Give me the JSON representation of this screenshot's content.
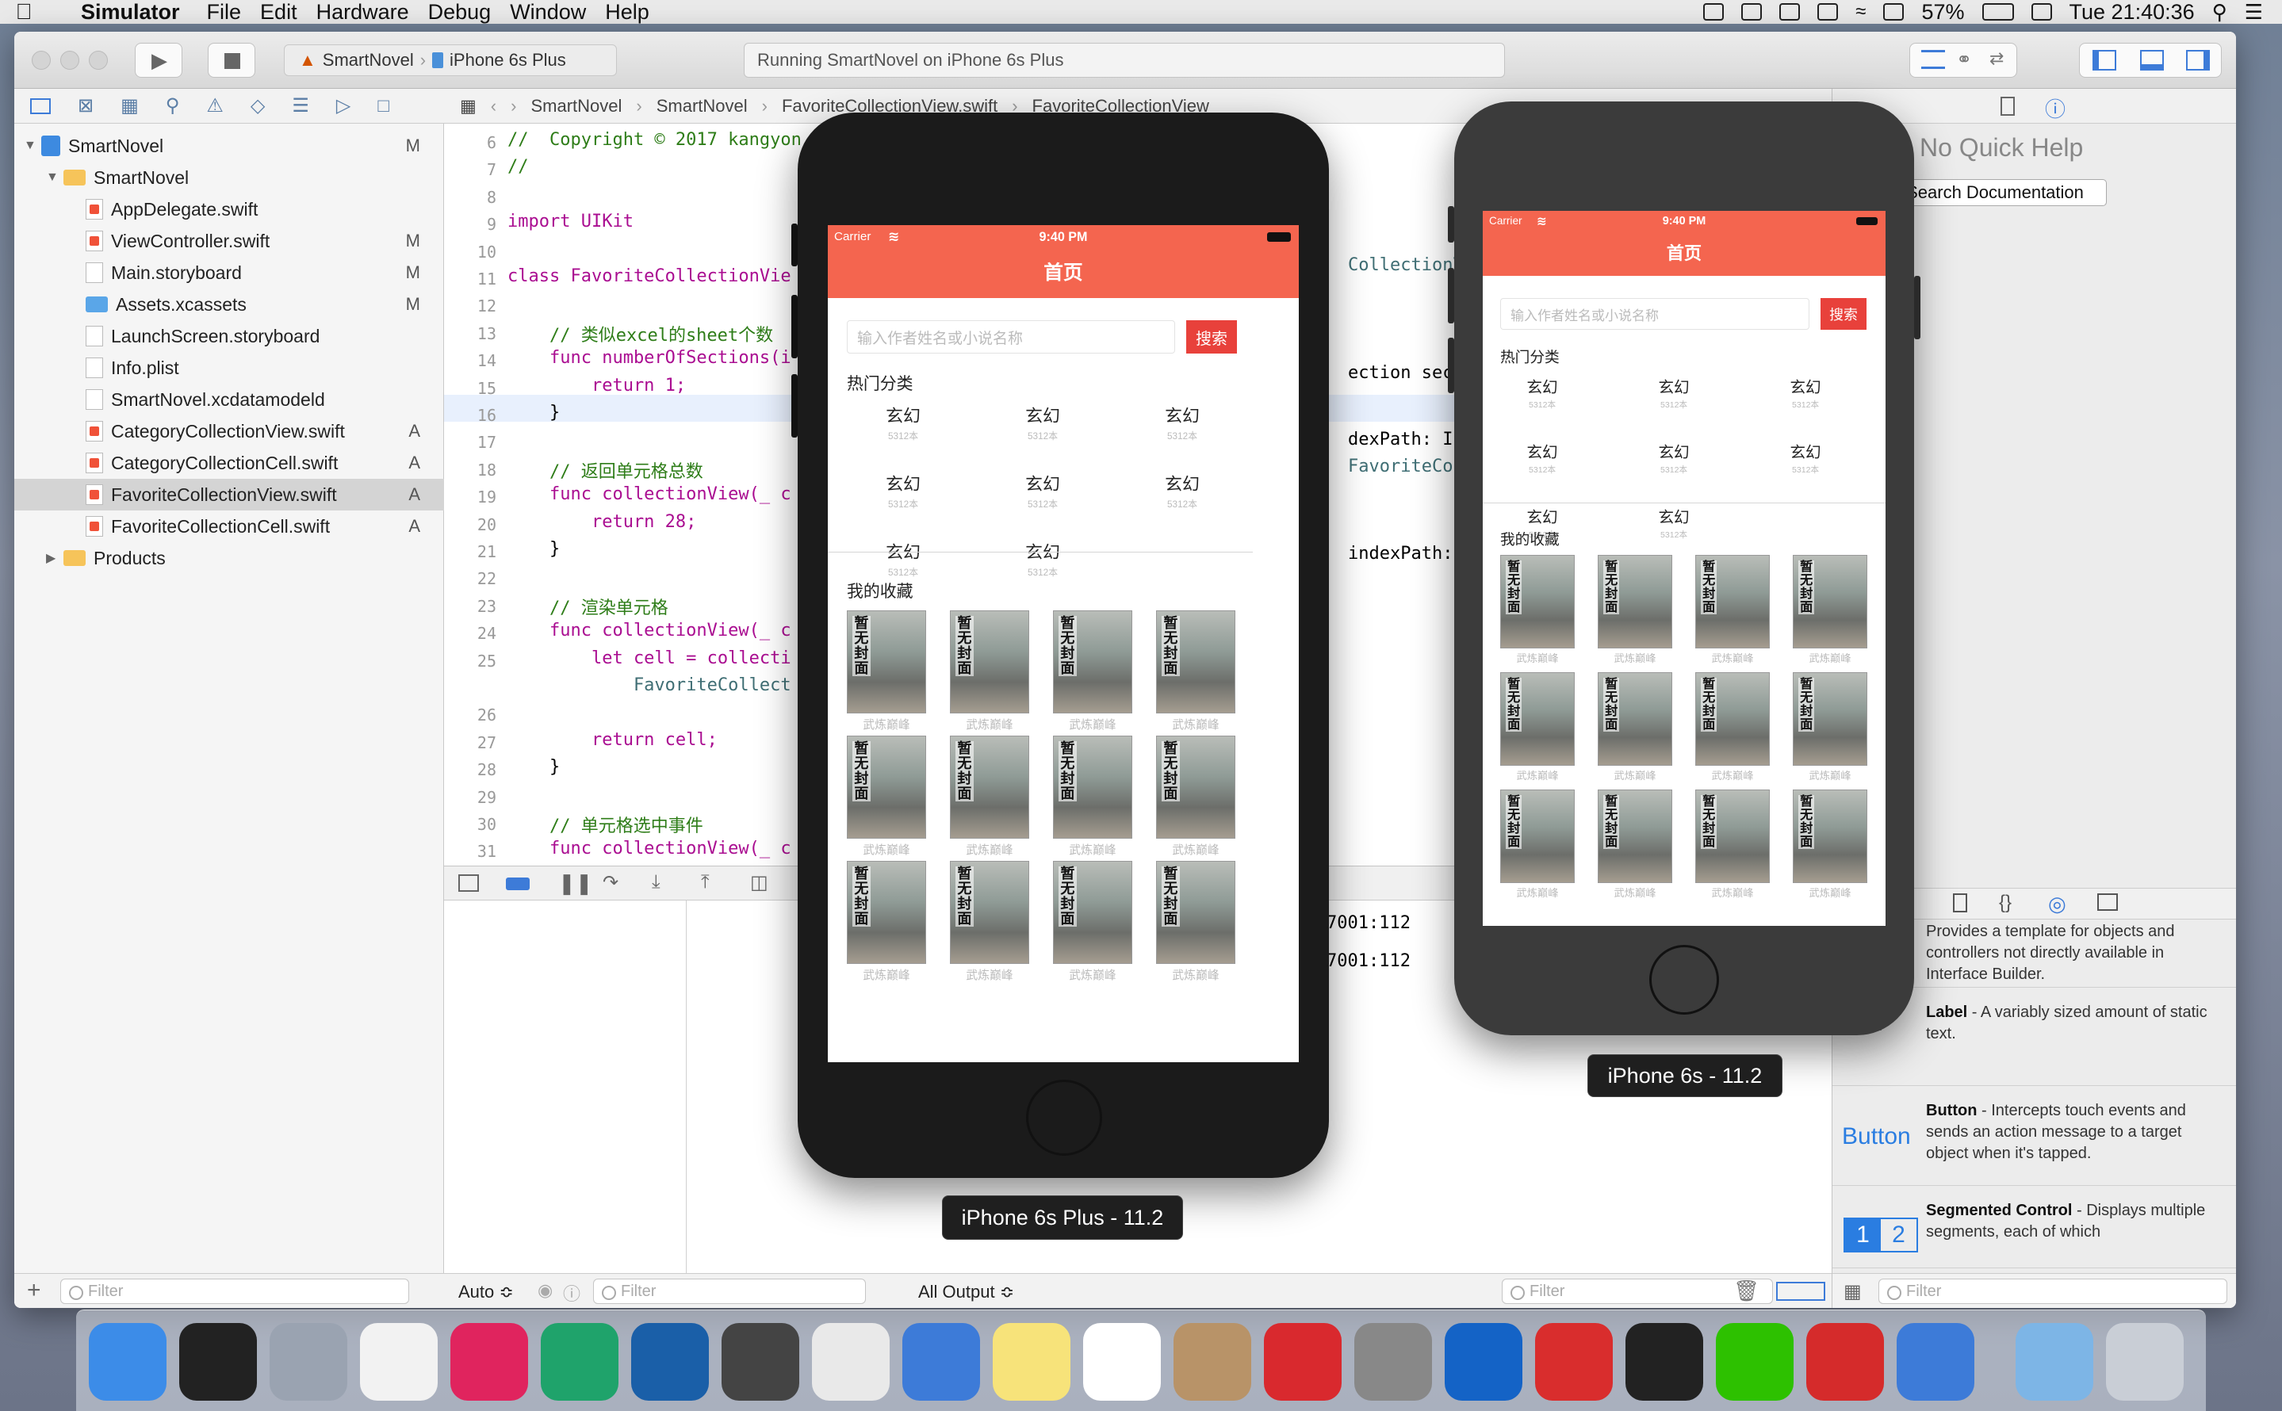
{
  "menubar": {
    "app": "Simulator",
    "items": [
      "File",
      "Edit",
      "Hardware",
      "Debug",
      "Window",
      "Help"
    ],
    "battery": "57%",
    "clock": "Tue 21:40:36"
  },
  "toolbar": {
    "scheme": "SmartNovel",
    "device": "iPhone 6s Plus",
    "status": "Running SmartNovel on iPhone 6s Plus"
  },
  "jumpbar": {
    "crumbs": [
      "SmartNovel",
      "SmartNovel",
      "FavoriteCollectionView.swift",
      "FavoriteCollectionView"
    ]
  },
  "navigator": {
    "items": [
      {
        "label": "SmartNovel",
        "badge": "M",
        "kind": "project",
        "level": 0
      },
      {
        "label": "SmartNovel",
        "badge": "",
        "kind": "folder",
        "level": 1
      },
      {
        "label": "AppDelegate.swift",
        "badge": "",
        "kind": "swift",
        "level": 2
      },
      {
        "label": "ViewController.swift",
        "badge": "M",
        "kind": "swift",
        "level": 2
      },
      {
        "label": "Main.storyboard",
        "badge": "M",
        "kind": "file",
        "level": 2
      },
      {
        "label": "Assets.xcassets",
        "badge": "M",
        "kind": "folder",
        "level": 2
      },
      {
        "label": "LaunchScreen.storyboard",
        "badge": "",
        "kind": "file",
        "level": 2
      },
      {
        "label": "Info.plist",
        "badge": "",
        "kind": "file",
        "level": 2
      },
      {
        "label": "SmartNovel.xcdatamodeld",
        "badge": "",
        "kind": "file",
        "level": 2
      },
      {
        "label": "CategoryCollectionView.swift",
        "badge": "A",
        "kind": "swift",
        "level": 2
      },
      {
        "label": "CategoryCollectionCell.swift",
        "badge": "A",
        "kind": "swift",
        "level": 2
      },
      {
        "label": "FavoriteCollectionView.swift",
        "badge": "A",
        "kind": "swift",
        "level": 2,
        "selected": true
      },
      {
        "label": "FavoriteCollectionCell.swift",
        "badge": "A",
        "kind": "swift",
        "level": 2
      },
      {
        "label": "Products",
        "badge": "",
        "kind": "folder",
        "level": 1
      }
    ],
    "filter_placeholder": "Filter"
  },
  "code": [
    {
      "n": "6",
      "t": "//  Copyright © 2017 kangyon",
      "c": "cm"
    },
    {
      "n": "7",
      "t": "//",
      "c": "cm"
    },
    {
      "n": "8",
      "t": "",
      "c": ""
    },
    {
      "n": "9",
      "t": "import UIKit",
      "c": "kw"
    },
    {
      "n": "10",
      "t": "",
      "c": ""
    },
    {
      "n": "11",
      "t": "class FavoriteCollectionVie",
      "c": "kw"
    },
    {
      "n": "12",
      "t": "",
      "c": ""
    },
    {
      "n": "13",
      "t": "    // 类似excel的sheet个数",
      "c": "cm"
    },
    {
      "n": "14",
      "t": "    func numberOfSections(i",
      "c": "kw"
    },
    {
      "n": "15",
      "t": "        return 1;",
      "c": "kw"
    },
    {
      "n": "16",
      "t": "    }",
      "c": ""
    },
    {
      "n": "17",
      "t": "",
      "c": ""
    },
    {
      "n": "18",
      "t": "    // 返回单元格总数",
      "c": "cm"
    },
    {
      "n": "19",
      "t": "    func collectionView(_ c",
      "c": "kw"
    },
    {
      "n": "20",
      "t": "        return 28;",
      "c": "kw"
    },
    {
      "n": "21",
      "t": "    }",
      "c": ""
    },
    {
      "n": "22",
      "t": "",
      "c": ""
    },
    {
      "n": "23",
      "t": "    // 渲染单元格",
      "c": "cm"
    },
    {
      "n": "24",
      "t": "    func collectionView(_ c",
      "c": "kw"
    },
    {
      "n": "25",
      "t": "        let cell = collecti",
      "c": "kw"
    },
    {
      "n": "",
      "t": "            FavoriteCollect",
      "c": "ty"
    },
    {
      "n": "26",
      "t": "",
      "c": ""
    },
    {
      "n": "27",
      "t": "        return cell;",
      "c": "kw"
    },
    {
      "n": "28",
      "t": "    }",
      "c": ""
    },
    {
      "n": "29",
      "t": "",
      "c": ""
    },
    {
      "n": "30",
      "t": "    // 单元格选中事件",
      "c": "cm"
    },
    {
      "n": "31",
      "t": "    func collectionView(_ c",
      "c": "kw"
    },
    {
      "n": "32",
      "t": "",
      "c": ""
    }
  ],
  "code_right": [
    {
      "t": "CollectionVi",
      "c": "ty"
    },
    {
      "t": "ection secti",
      "c": ""
    },
    {
      "t": "dexPath: Ind",
      "c": ""
    },
    {
      "t": "FavoriteColl",
      "c": "ty"
    },
    {
      "t": "indexPath: I",
      "c": ""
    }
  ],
  "console": {
    "lines": [
      "el[27001:112",
      "el[27001:112"
    ],
    "auto_label": "Auto ≎",
    "output_label": "All Output ≎",
    "filter_placeholder": "Filter"
  },
  "inspector": {
    "quick_help": "No Quick Help",
    "search_button": "Search Documentation",
    "library": [
      {
        "title": "Object",
        "desc": "Provides a template for objects and controllers not directly available in Interface Builder."
      },
      {
        "title": "Label",
        "desc": "A variably sized amount of static text.",
        "icon": "L"
      },
      {
        "title": "Button",
        "desc": "Intercepts touch events and sends an action message to a target object when it's tapped.",
        "icon": "Button"
      },
      {
        "title": "Segmented Control",
        "desc": "Displays multiple segments, each of which",
        "icon": "1 2"
      }
    ],
    "filter_placeholder": "Filter"
  },
  "app_screen": {
    "carrier": "Carrier",
    "time": "9:40 PM",
    "title": "首页",
    "search_placeholder": "输入作者姓名或小说名称",
    "search_button": "搜索",
    "hot_title": "热门分类",
    "category_name": "玄幻",
    "category_count": "5312本",
    "fav_title": "我的收藏",
    "cover_text": "暂无封面",
    "cover_author": "武炼巅峰"
  },
  "sim_labels": {
    "plus": "iPhone 6s Plus - 11.2",
    "s": "iPhone 6s - 11.2"
  },
  "dock": {
    "apps": [
      "finder-icon",
      "terminal-icon",
      "launchpad-icon",
      "chrome-icon",
      "intellij-icon",
      "datagrip-icon",
      "sourcetree-icon",
      "sublime-icon",
      "markdown-icon",
      "xcode-icon",
      "notes-icon",
      "reminders-icon",
      "archive-icon",
      "gitee-icon",
      "sysprefs-icon",
      "word-icon",
      "youdao-icon",
      "qq-icon",
      "wechat-icon",
      "netease-music-icon",
      "simulator-icon",
      "downloads-icon",
      "trash-icon"
    ]
  }
}
